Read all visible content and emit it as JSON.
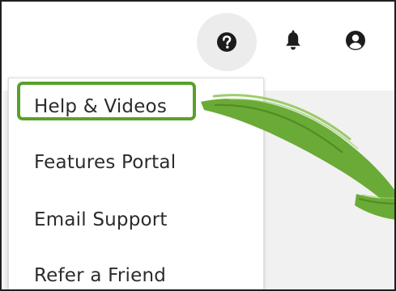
{
  "header": {
    "help_icon": "question-circle-icon",
    "notifications_icon": "bell-icon",
    "account_icon": "user-circle-icon"
  },
  "help_menu": {
    "items": [
      {
        "label": "Help & Videos"
      },
      {
        "label": "Features Portal"
      },
      {
        "label": "Email Support"
      },
      {
        "label": "Refer a Friend"
      }
    ]
  },
  "annotation": {
    "highlight_color": "#5aa02c",
    "highlighted_item": "Help & Videos"
  }
}
